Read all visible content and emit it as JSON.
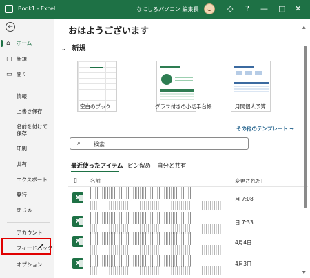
{
  "titlebar": {
    "app_title": "Book1 - Excel",
    "user_name": "なにしろパソコン 編集長",
    "icons": [
      "diamond-icon",
      "help-icon",
      "minimize-icon",
      "maximize-icon",
      "close-icon"
    ],
    "glyphs": {
      "diamond": "◇",
      "help": "?",
      "minimize": "—",
      "maximize": "□",
      "close": "✕"
    }
  },
  "sidebar": {
    "back_glyph": "←",
    "home": {
      "label": "ホーム",
      "glyph": "⌂"
    },
    "new": {
      "label": "新規",
      "glyph": "▢"
    },
    "open": {
      "label": "開く",
      "glyph": "▭"
    },
    "items": [
      "情報",
      "上書き保存",
      "名前を付けて保存",
      "印刷",
      "共有",
      "エクスポート",
      "発行",
      "閉じる"
    ],
    "bottom_items": [
      "アカウント",
      "フィードバック",
      "オプション"
    ]
  },
  "main": {
    "greeting": "おはようございます",
    "new_section": {
      "chevron": "⌄",
      "label": "新規"
    },
    "templates": [
      {
        "label": "空白のブック"
      },
      {
        "label": "グラフ付きの小切手台帳"
      },
      {
        "label": "月間個人予算"
      }
    ],
    "more_templates": "その他のテンプレート →",
    "search": {
      "icon_glyph": "⌕",
      "placeholder": "検索"
    },
    "tabs": [
      "最近使ったアイテム",
      "ピン留め",
      "自分と共有"
    ],
    "columns": {
      "name": "名前",
      "modified": "変更された日"
    },
    "files": [
      {
        "date": "月 7:08"
      },
      {
        "date": "日 7:33"
      },
      {
        "date": "4月4日"
      },
      {
        "date": "4月3日"
      }
    ],
    "file_icon_letter": "X"
  },
  "colors": {
    "brand": "#1e7145",
    "highlight": "#e00000"
  }
}
